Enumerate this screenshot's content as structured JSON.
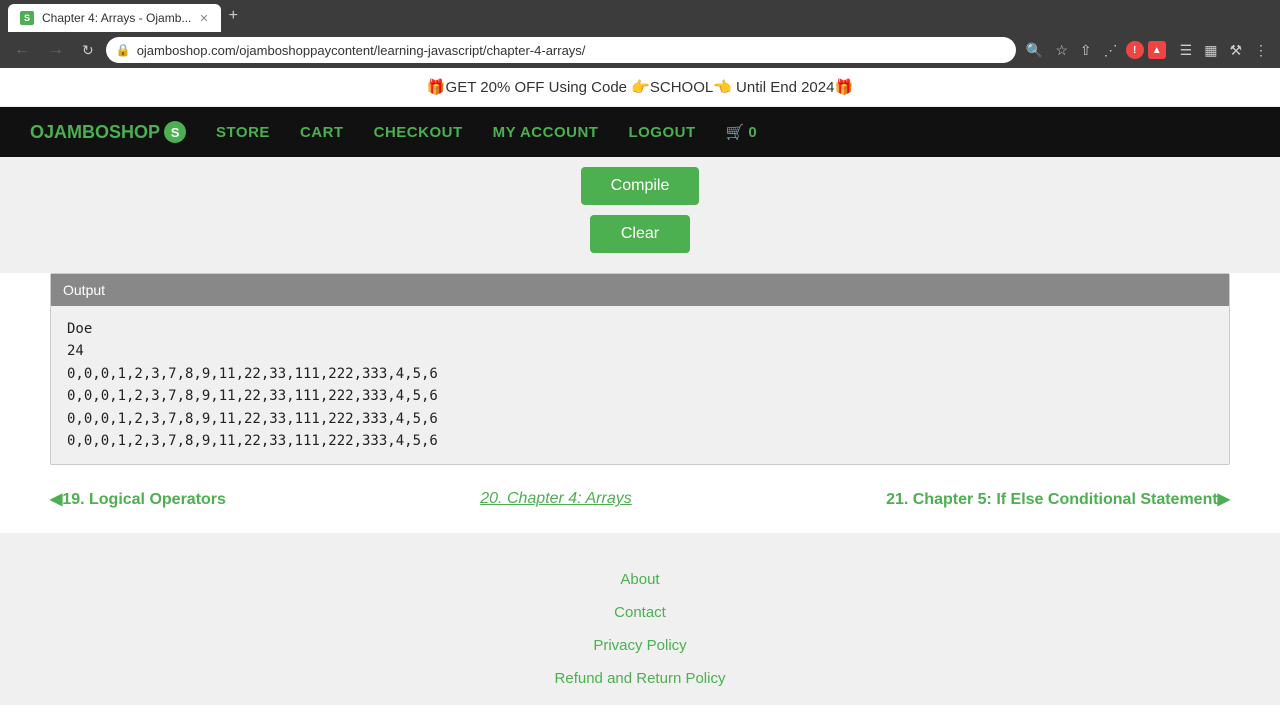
{
  "browser": {
    "tab_title": "Chapter 4: Arrays - Ojamb...",
    "tab_favicon": "S",
    "url": "ojamboshop.com/ojamboshoppaycontent/learning-javascript/chapter-4-arrays/",
    "new_tab_label": "+",
    "back_disabled": false,
    "forward_disabled": true
  },
  "promo": {
    "text": "🎁GET 20% OFF Using Code 👉SCHOOL👈 Until End 2024🎁"
  },
  "nav": {
    "logo": "OJAMBOSHOP",
    "logo_s": "S",
    "store": "STORE",
    "cart": "CART",
    "checkout": "CHECKOUT",
    "my_account": "MY ACCOUNT",
    "logout": "LOGOUT",
    "cart_icon": "🛒",
    "cart_count": "0"
  },
  "buttons": {
    "compile": "Compile",
    "clear": "Clear"
  },
  "output": {
    "header": "Output",
    "lines": [
      "Doe",
      "24",
      "0,0,0,1,2,3,7,8,9,11,22,33,111,222,333,4,5,6",
      "0,0,0,1,2,3,7,8,9,11,22,33,111,222,333,4,5,6",
      "0,0,0,1,2,3,7,8,9,11,22,33,111,222,333,4,5,6",
      "0,0,0,1,2,3,7,8,9,11,22,33,111,222,333,4,5,6"
    ]
  },
  "page_nav": {
    "prev_label": "◀19. Logical Operators",
    "current_label": "20. Chapter 4: Arrays",
    "next_label": "21. Chapter 5: If Else Conditional Statement▶"
  },
  "footer": {
    "links": [
      "About",
      "Contact",
      "Privacy Policy",
      "Refund and Return Policy"
    ]
  }
}
